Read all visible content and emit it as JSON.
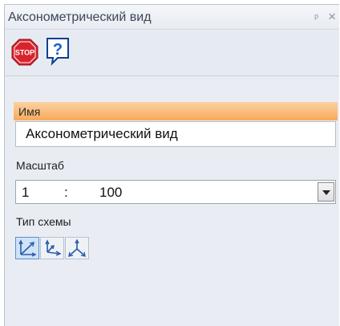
{
  "panel": {
    "title": "Аксонометрический вид",
    "pin_glyph": "ᵖ",
    "close_glyph": "×"
  },
  "toolbar": {
    "stop_icon": "stop-sign-icon",
    "stop_text": "STOP",
    "help_icon": "help-question-icon",
    "help_text": "?"
  },
  "name_section": {
    "header": "Имя",
    "value": "Аксонометрический вид"
  },
  "scale": {
    "label": "Масштаб",
    "left": "1",
    "separator": ":",
    "right": "100"
  },
  "schema": {
    "label": "Тип схемы",
    "buttons": [
      {
        "icon": "isometric-axes-icon",
        "selected": true
      },
      {
        "icon": "dimetric-axes-icon",
        "selected": false
      },
      {
        "icon": "trimetric-axes-icon",
        "selected": false
      }
    ]
  },
  "colors": {
    "section_bar_top": "#fbd2a2",
    "section_bar_bottom": "#f8a95a",
    "stop_red": "#d9232d",
    "help_blue": "#1b5fcf",
    "axes_blue": "#2b5aa8"
  }
}
